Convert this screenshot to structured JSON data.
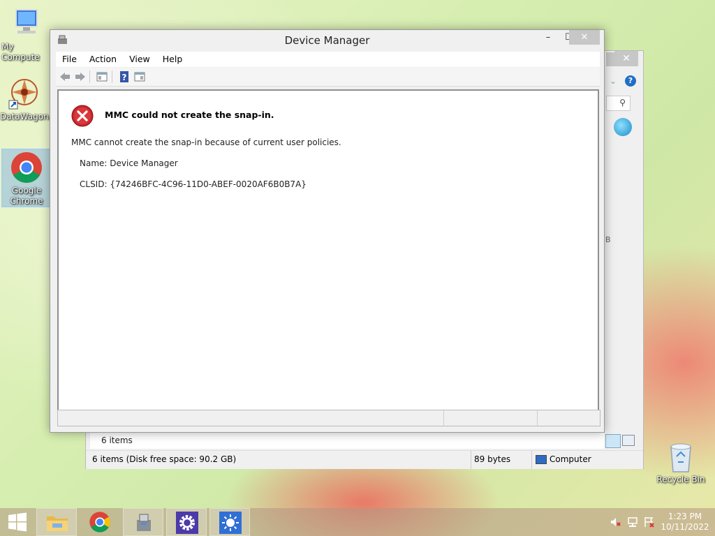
{
  "desktop": {
    "icons": [
      {
        "label": "My Compute"
      },
      {
        "label": "DataWagon..."
      },
      {
        "label": "Google Chrome"
      },
      {
        "label": "Recycle Bin"
      }
    ]
  },
  "explorer": {
    "close": "✕",
    "help": "?",
    "partial_text": "B",
    "items_count": "6 items",
    "status_left": "6 items (Disk free space: 90.2 GB)",
    "status_size": "89 bytes",
    "status_location": "Computer"
  },
  "device_manager": {
    "title": "Device Manager",
    "controls": {
      "minimize": "–",
      "maximize": "☐",
      "close": "✕"
    },
    "menu": [
      "File",
      "Action",
      "View",
      "Help"
    ],
    "error": {
      "heading": "MMC could not create the snap-in.",
      "message": "MMC cannot create the snap-in because of current user policies.",
      "name": "Name: Device Manager",
      "clsid": "CLSID: {74246BFC-4C96-11D0-ABEF-0020AF6B0B7A}"
    }
  },
  "taskbar": {
    "clock_time": "1:23 PM",
    "clock_date": "10/11/2022"
  },
  "colors": {
    "error_red": "#c8262b",
    "chrome_red": "#db4437",
    "chrome_yellow": "#f4c20d",
    "chrome_green": "#0f9d58",
    "chrome_blue": "#4285f4",
    "settings_purple": "#4b3aa8",
    "brightness_blue": "#2f6fd6"
  }
}
